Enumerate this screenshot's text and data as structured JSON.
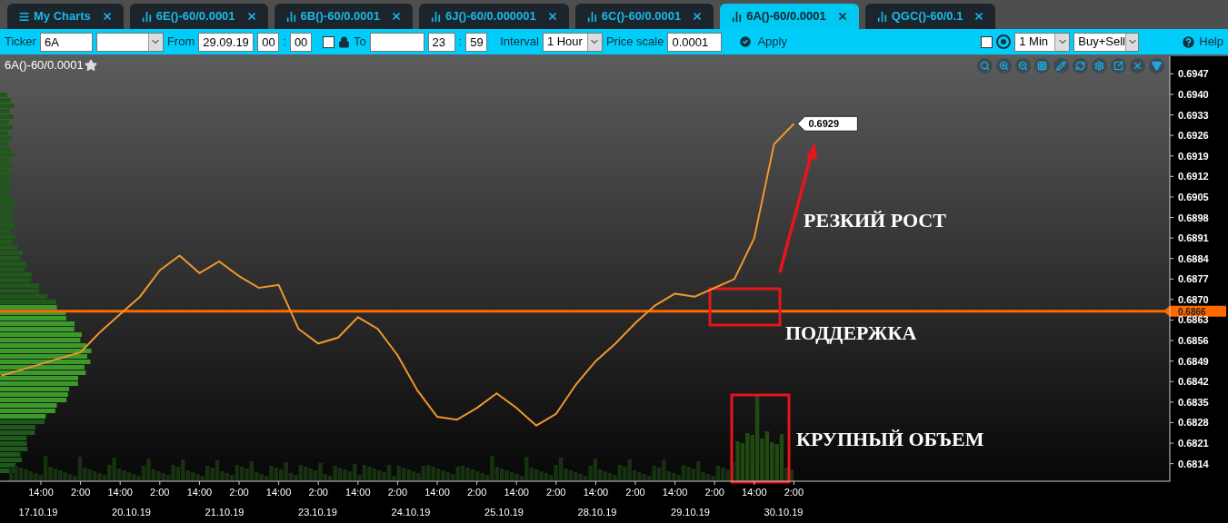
{
  "tabs": [
    {
      "label": "My Charts",
      "kind": "menu",
      "selected": false
    },
    {
      "label": "6E()-60/0.0001",
      "kind": "chart",
      "selected": false
    },
    {
      "label": "6B()-60/0.0001",
      "kind": "chart",
      "selected": false
    },
    {
      "label": "6J()-60/0.000001",
      "kind": "chart",
      "selected": false
    },
    {
      "label": "6C()-60/0.0001",
      "kind": "chart",
      "selected": false
    },
    {
      "label": "6A()-60/0.0001",
      "kind": "chart",
      "selected": true
    },
    {
      "label": "QGC()-60/0.1",
      "kind": "chart",
      "selected": false
    }
  ],
  "toolbar": {
    "ticker_label": "Ticker",
    "ticker": "6A",
    "from_label": "From",
    "from_date": "29.09.19",
    "from_hour": "00",
    "from_separator": ":",
    "from_minute": "00",
    "lock_checked": false,
    "to_label": "To",
    "to_hour": "23",
    "to_separator": ":",
    "to_minute": "59",
    "interval_label": "Interval",
    "interval": "1 Hour",
    "price_scale_label": "Price scale",
    "price_scale": "0.0001",
    "apply": "Apply",
    "auto_checked": false,
    "timeframe": "1 Min",
    "side": "Buy+Sell",
    "help": "Help"
  },
  "chart": {
    "title": "6A()-60/0.0001",
    "favorite": true,
    "last_price_label": "0.6929",
    "date_labels": [
      "17.10.19",
      "20.10.19",
      "21.10.19",
      "23.10.19",
      "24.10.19",
      "25.10.19",
      "28.10.19",
      "29.10.19",
      "30.10.19"
    ],
    "chart_data": {
      "type": "line",
      "ylim": [
        0.6808,
        0.6953
      ],
      "categories": [
        null,
        null,
        "14:00",
        null,
        "2:00",
        null,
        "14:00",
        null,
        "2:00",
        null,
        "14:00",
        null,
        "2:00",
        null,
        "14:00",
        null,
        "2:00",
        null,
        "14:00",
        null,
        "2:00",
        null,
        "14:00",
        null,
        "2:00",
        null,
        "14:00",
        null,
        "2:00",
        null,
        "14:00",
        null,
        "2:00",
        null,
        "14:00",
        null,
        "2:00",
        null,
        "14:00",
        null,
        "2:00"
      ],
      "yticks": [
        {
          "value": 0.6947,
          "label": "0.6947"
        },
        {
          "value": 0.694,
          "label": "0.6940"
        },
        {
          "value": 0.6933,
          "label": "0.6933"
        },
        {
          "value": 0.6926,
          "label": "0.6926"
        },
        {
          "value": 0.6919,
          "label": "0.6919"
        },
        {
          "value": 0.6912,
          "label": "0.6912"
        },
        {
          "value": 0.6905,
          "label": "0.6905"
        },
        {
          "value": 0.6898,
          "label": "0.6898"
        },
        {
          "value": 0.6891,
          "label": "0.6891"
        },
        {
          "value": 0.6884,
          "label": "0.6884"
        },
        {
          "value": 0.6877,
          "label": "0.6877"
        },
        {
          "value": 0.687,
          "label": "0.6870"
        },
        {
          "value": 0.6863,
          "label": "0.6863"
        },
        {
          "value": 0.6856,
          "label": "0.6856"
        },
        {
          "value": 0.6849,
          "label": "0.6849"
        },
        {
          "value": 0.6842,
          "label": "0.6842"
        },
        {
          "value": 0.6835,
          "label": "0.6835"
        },
        {
          "value": 0.6828,
          "label": "0.6828"
        },
        {
          "value": 0.6821,
          "label": "0.6821"
        },
        {
          "value": 0.6814,
          "label": "0.6814"
        }
      ],
      "series": [
        {
          "color": "#f0962e",
          "values": [
            0.6844,
            0.6846,
            0.6848,
            0.685,
            0.6852,
            0.6859,
            0.6865,
            0.6871,
            0.688,
            0.6885,
            0.6879,
            0.6883,
            0.6878,
            0.6874,
            0.6875,
            0.686,
            0.6855,
            0.6857,
            0.6864,
            0.686,
            0.6851,
            0.6839,
            0.683,
            0.6829,
            0.6833,
            0.6838,
            0.6833,
            0.6827,
            0.6831,
            0.6841,
            0.6849,
            0.6855,
            0.6862,
            0.6868,
            0.6872,
            0.6871,
            0.6874,
            0.6877,
            0.6891,
            0.6923,
            0.693
          ]
        }
      ]
    },
    "support_line": {
      "label": "0.6866"
    },
    "notes": [
      {
        "kind": "arrow",
        "text": "РЕЗКИЙ РОСТ"
      },
      {
        "kind": "support",
        "text": "ПОДДЕРЖКА"
      },
      {
        "kind": "volume",
        "text": "КРУПНЫЙ ОБЪЕМ"
      }
    ]
  }
}
